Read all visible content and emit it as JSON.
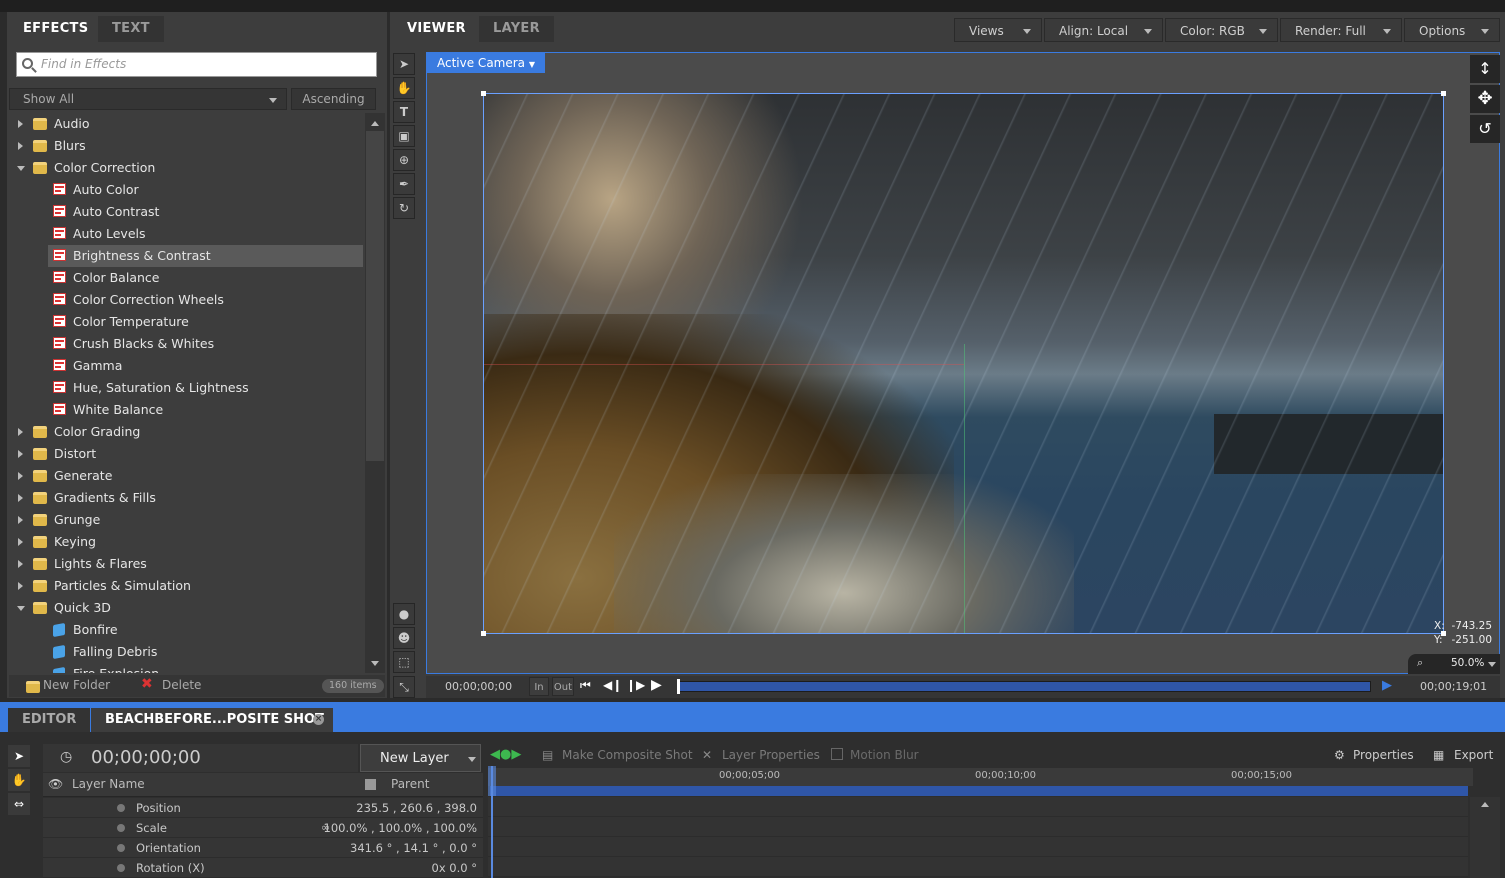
{
  "left_panel": {
    "tabs": [
      "EFFECTS",
      "TEXT"
    ],
    "search_placeholder": "Find in Effects",
    "filter": "Show All",
    "sort": "Ascending",
    "tree": [
      {
        "label": "Audio",
        "type": "folder",
        "open": false
      },
      {
        "label": "Blurs",
        "type": "folder",
        "open": false
      },
      {
        "label": "Color Correction",
        "type": "folder",
        "open": true
      },
      {
        "label": "Auto Color",
        "type": "effect"
      },
      {
        "label": "Auto Contrast",
        "type": "effect"
      },
      {
        "label": "Auto Levels",
        "type": "effect"
      },
      {
        "label": "Brightness & Contrast",
        "type": "effect",
        "selected": true
      },
      {
        "label": "Color Balance",
        "type": "effect"
      },
      {
        "label": "Color Correction Wheels",
        "type": "effect"
      },
      {
        "label": "Color Temperature",
        "type": "effect"
      },
      {
        "label": "Crush Blacks & Whites",
        "type": "effect"
      },
      {
        "label": "Gamma",
        "type": "effect"
      },
      {
        "label": "Hue, Saturation & Lightness",
        "type": "effect"
      },
      {
        "label": "White Balance",
        "type": "effect"
      },
      {
        "label": "Color Grading",
        "type": "folder",
        "open": false
      },
      {
        "label": "Distort",
        "type": "folder",
        "open": false
      },
      {
        "label": "Generate",
        "type": "folder",
        "open": false
      },
      {
        "label": "Gradients & Fills",
        "type": "folder",
        "open": false
      },
      {
        "label": "Grunge",
        "type": "folder",
        "open": false
      },
      {
        "label": "Keying",
        "type": "folder",
        "open": false
      },
      {
        "label": "Lights & Flares",
        "type": "folder",
        "open": false
      },
      {
        "label": "Particles & Simulation",
        "type": "folder",
        "open": false
      },
      {
        "label": "Quick 3D",
        "type": "folder",
        "open": true
      },
      {
        "label": "Bonfire",
        "type": "preset"
      },
      {
        "label": "Falling Debris",
        "type": "preset"
      },
      {
        "label": "Fire Explosion",
        "type": "preset"
      }
    ],
    "footer": {
      "new_folder": "New Folder",
      "delete": "Delete",
      "count": "160 items"
    }
  },
  "viewer": {
    "tabs": [
      "VIEWER",
      "LAYER"
    ],
    "buttons": [
      "Views",
      "Align: Local",
      "Color: RGB",
      "Render: Full",
      "Options"
    ],
    "camera": "Active Camera",
    "coords": {
      "x_label": "X:",
      "x": "-743.25",
      "y_label": "Y:",
      "y": "-251.00"
    },
    "zoom": "50.0%",
    "transport": {
      "start_time": "00;00;00;00",
      "in": "In",
      "out": "Out",
      "end_time": "00;00;19;01"
    }
  },
  "editor": {
    "tabs": [
      "EDITOR",
      "BEACHBEFORE...POSITE SHOT"
    ],
    "timecode": "00;00;00;00",
    "new_layer": "New Layer",
    "toolbar": {
      "make_composite": "Make Composite Shot",
      "layer_properties": "Layer Properties",
      "motion_blur": "Motion Blur",
      "properties": "Properties",
      "export": "Export"
    },
    "columns": {
      "layer_name": "Layer Name",
      "parent": "Parent"
    },
    "ruler": [
      "00;00;05;00",
      "00;00;10;00",
      "00;00;15;00"
    ],
    "properties": [
      {
        "name": "Position",
        "value": "235.5 ,  260.6 ,  398.0"
      },
      {
        "name": "Scale",
        "value": "100.0% ,  100.0% ,  100.0%"
      },
      {
        "name": "Orientation",
        "value": "341.6 ° ,  14.1 ° ,   0.0 °"
      },
      {
        "name": "Rotation (X)",
        "value": "0x    0.0 °"
      }
    ]
  },
  "colors": {
    "accent": "#3a7be0",
    "selection": "#5a5a5a",
    "folder": "#e0b84a"
  }
}
